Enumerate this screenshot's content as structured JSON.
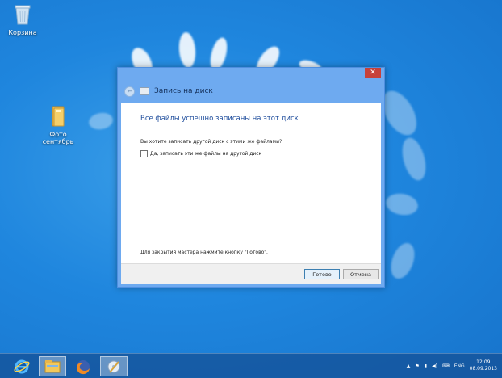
{
  "desktop": {
    "icons": [
      {
        "label": "Корзина"
      },
      {
        "label": "Фото сентябрь"
      }
    ]
  },
  "dialog": {
    "close_label": "✕",
    "title": "Запись на диск",
    "heading": "Все файлы успешно записаны на этот диск",
    "question": "Вы хотите записать другой диск с этими же файлами?",
    "checkbox_label": "Да, записать эти же файлы на другой диск",
    "checkbox_checked": false,
    "finish_hint": "Для закрытия мастера нажмите кнопку \"Готово\".",
    "buttons": {
      "done": "Готово",
      "cancel": "Отмена"
    }
  },
  "taskbar": {
    "apps": [
      {
        "icon": "internet-explorer-icon"
      },
      {
        "icon": "file-explorer-icon"
      },
      {
        "icon": "firefox-icon"
      },
      {
        "icon": "disc-burner-icon"
      }
    ],
    "tray": {
      "language": "ENG",
      "time": "12:09",
      "date": "08.09.2013"
    }
  }
}
